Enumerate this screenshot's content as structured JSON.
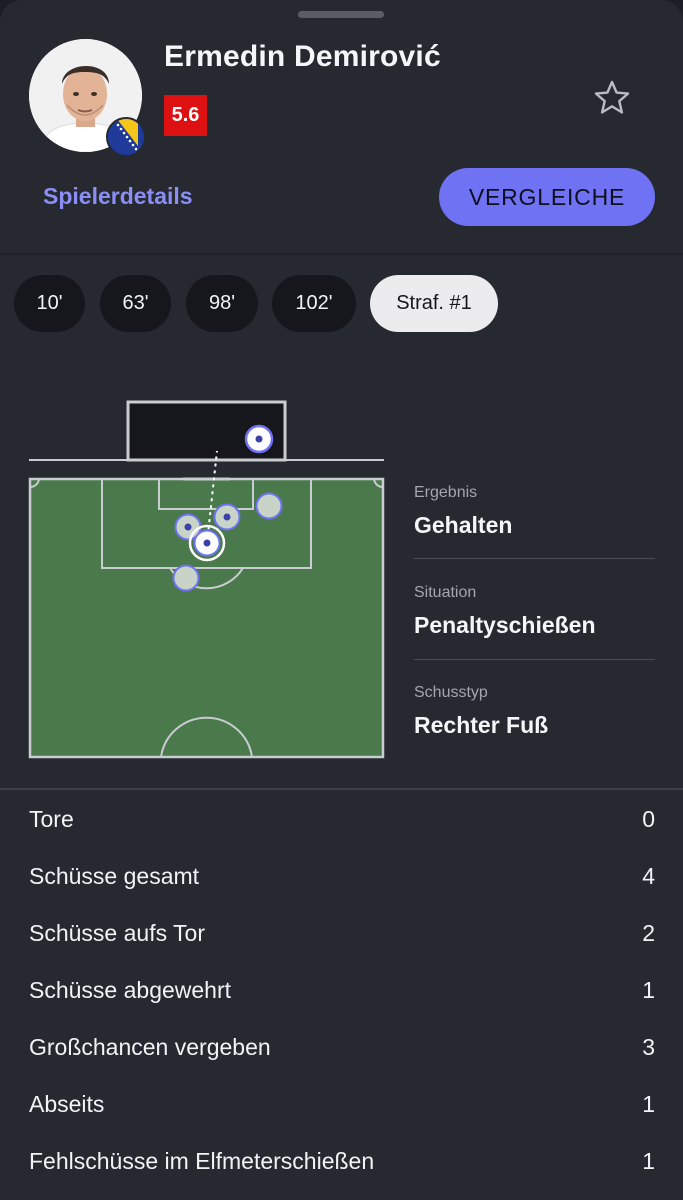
{
  "player": {
    "name": "Ermedin Demirović",
    "rating": "5.6"
  },
  "links": {
    "details_label": "Spielerdetails",
    "compare_label": "VERGLEICHE"
  },
  "shot_chips": [
    {
      "label": "10'",
      "active": false
    },
    {
      "label": "63'",
      "active": false
    },
    {
      "label": "98'",
      "active": false
    },
    {
      "label": "102'",
      "active": false
    },
    {
      "label": "Straf. #1",
      "active": true
    }
  ],
  "shot_info": {
    "result_label": "Ergebnis",
    "result_value": "Gehalten",
    "situation_label": "Situation",
    "situation_value": "Penaltyschießen",
    "shot_type_label": "Schusstyp",
    "shot_type_value": "Rechter Fuß"
  },
  "stats": [
    {
      "label": "Tore",
      "value": "0"
    },
    {
      "label": "Schüsse gesamt",
      "value": "4"
    },
    {
      "label": "Schüsse aufs Tor",
      "value": "2"
    },
    {
      "label": "Schüsse abgewehrt",
      "value": "1"
    },
    {
      "label": "Großchancen vergeben",
      "value": "3"
    },
    {
      "label": "Abseits",
      "value": "1"
    },
    {
      "label": "Fehlschüsse im Elfmeterschießen",
      "value": "1"
    }
  ],
  "colors": {
    "accent": "#6f72f2",
    "rating_bg": "#dd1111",
    "pitch": "#4a7a4c",
    "background": "#262930"
  },
  "icons": {
    "favorite": "star-outline-icon",
    "flag": "bosnia-flag-icon"
  }
}
